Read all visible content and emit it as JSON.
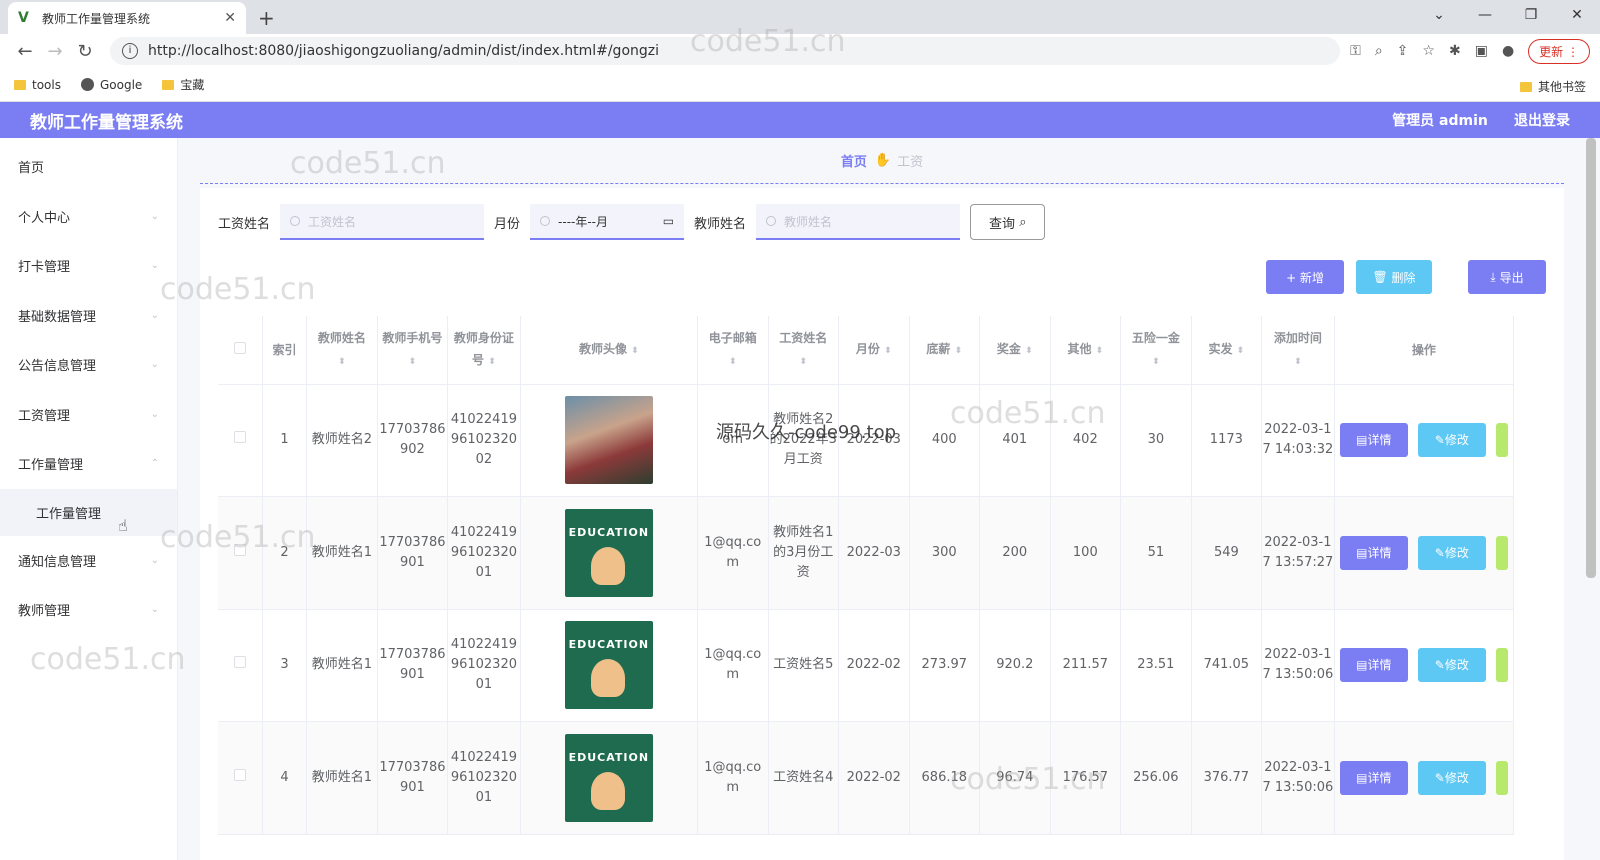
{
  "browser": {
    "tab_title": "教师工作量管理系统",
    "url": "http://localhost:8080/jiaoshigongzuoliang/admin/dist/index.html#/gongzi",
    "update_label": "更新",
    "bookmarks": [
      "tools",
      "Google",
      "宝藏"
    ],
    "other_bookmarks": "其他书签"
  },
  "header": {
    "title": "教师工作量管理系统",
    "user": "管理员 admin",
    "logout": "退出登录"
  },
  "sidebar": {
    "items": [
      {
        "label": "首页"
      },
      {
        "label": "个人中心"
      },
      {
        "label": "打卡管理"
      },
      {
        "label": "基础数据管理"
      },
      {
        "label": "公告信息管理"
      },
      {
        "label": "工资管理"
      },
      {
        "label": "工作量管理"
      },
      {
        "label": "工作量管理"
      },
      {
        "label": "通知信息管理"
      },
      {
        "label": "教师管理"
      }
    ]
  },
  "breadcrumb": {
    "home": "首页",
    "current": "工资"
  },
  "search": {
    "salary_label": "工资姓名",
    "salary_placeholder": "工资姓名",
    "month_label": "月份",
    "month_value": "----年--月",
    "teacher_label": "教师姓名",
    "teacher_placeholder": "教师姓名",
    "query_button": "查询"
  },
  "actions": {
    "add": "+ 新增",
    "delete": "删除",
    "export": "导出"
  },
  "table": {
    "headers": [
      "索引",
      "教师姓名",
      "教师手机号",
      "教师身份证号",
      "教师头像",
      "电子邮箱",
      "工资姓名",
      "月份",
      "底薪",
      "奖金",
      "其他",
      "五险一金",
      "实发",
      "添加时间",
      "操作"
    ],
    "rows": [
      {
        "index": "1",
        "teacher": "教师姓名2",
        "phone": "17703786902",
        "idcard": "410224199610232002",
        "email": "om",
        "salary_name": "教师姓名2的2022年3月工资",
        "month": "2022-03",
        "base": "400",
        "bonus": "401",
        "other": "402",
        "insurance": "30",
        "net": "1173",
        "time": "2022-03-17 14:03:32"
      },
      {
        "index": "2",
        "teacher": "教师姓名1",
        "phone": "17703786901",
        "idcard": "410224199610232001",
        "email": "1@qq.com",
        "salary_name": "教师姓名1的3月份工资",
        "month": "2022-03",
        "base": "300",
        "bonus": "200",
        "other": "100",
        "insurance": "51",
        "net": "549",
        "time": "2022-03-17 13:57:27"
      },
      {
        "index": "3",
        "teacher": "教师姓名1",
        "phone": "17703786901",
        "idcard": "410224199610232001",
        "email": "1@qq.com",
        "salary_name": "工资姓名5",
        "month": "2022-02",
        "base": "273.97",
        "bonus": "920.2",
        "other": "211.57",
        "insurance": "23.51",
        "net": "741.05",
        "time": "2022-03-17 13:50:06"
      },
      {
        "index": "4",
        "teacher": "教师姓名1",
        "phone": "17703786901",
        "idcard": "410224199610232001",
        "email": "1@qq.com",
        "salary_name": "工资姓名4",
        "month": "2022-02",
        "base": "686.18",
        "bonus": "96.74",
        "other": "176.57",
        "insurance": "256.06",
        "net": "376.77",
        "time": "2022-03-17 13:50:06"
      }
    ],
    "detail_label": "详情",
    "edit_label": "修改"
  },
  "watermarks": [
    "code51.cn",
    "源码久久-code99.top"
  ]
}
